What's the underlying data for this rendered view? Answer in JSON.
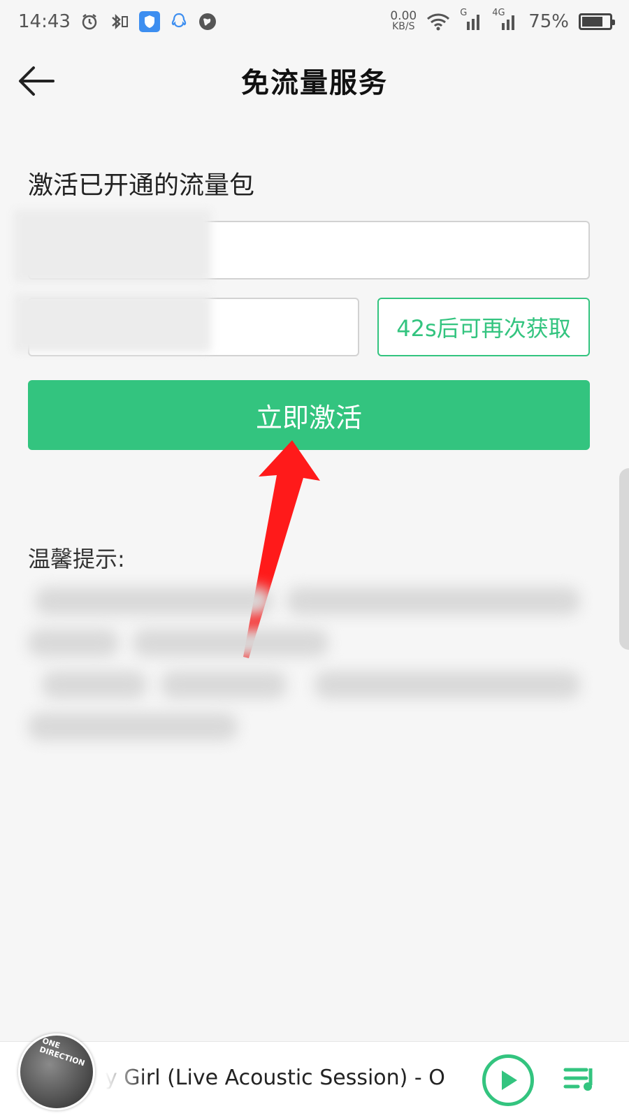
{
  "status_bar": {
    "time": "14:43",
    "net_speed_value": "0.00",
    "net_speed_unit": "KB/S",
    "signal_labels": [
      "G",
      "4G"
    ],
    "battery": "75%",
    "battery_level": 0.75,
    "icons": [
      "alarm-icon",
      "bluetooth-icon",
      "shield-icon",
      "qq-icon",
      "globe-icon",
      "wifi-icon",
      "signal-icon",
      "battery-icon"
    ]
  },
  "header": {
    "title": "免流量服务",
    "back_icon": "arrow-left-icon"
  },
  "form": {
    "section_title": "激活已开通的流量包",
    "phone_value": "",
    "code_value": "",
    "resend_label": "42s后可再次获取",
    "activate_label": "立即激活"
  },
  "tips": {
    "title": "温馨提示:"
  },
  "player": {
    "song_title": "y  Girl (Live  Acoustic  Session) - O",
    "album_text": "ONE DIRECTION",
    "play_icon": "play-icon",
    "playlist_icon": "playlist-icon"
  },
  "colors": {
    "accent": "#33c47f",
    "background": "#f6f6f6",
    "arrow": "#ff1a1a"
  }
}
